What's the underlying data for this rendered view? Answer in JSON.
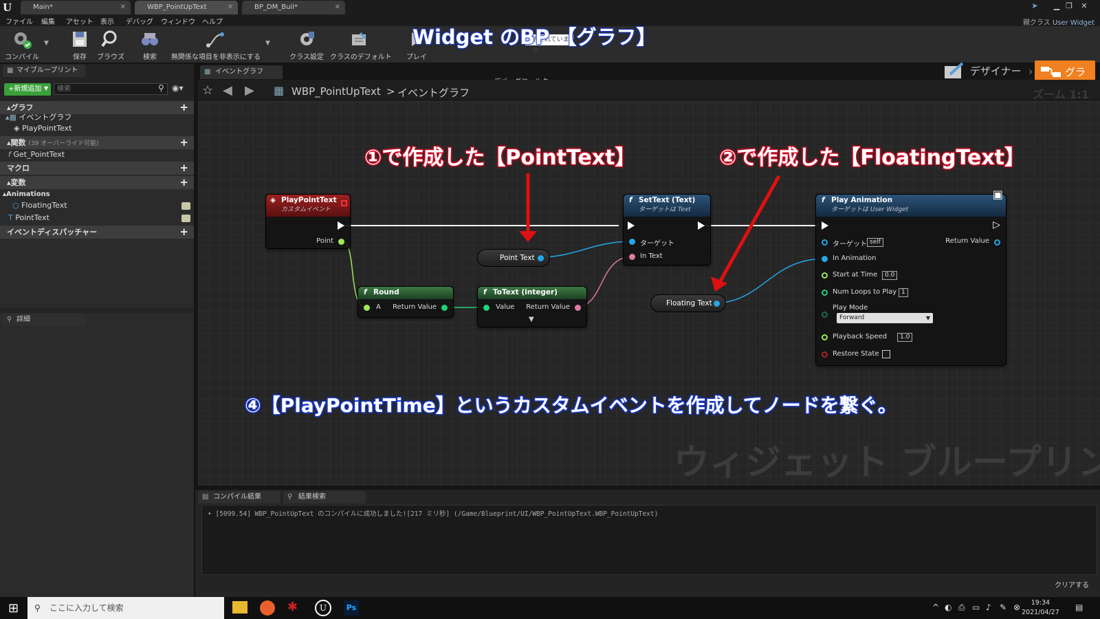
{
  "app": {
    "tabs": [
      {
        "label": "Main*",
        "active": false
      },
      {
        "label": "WBP_PointUpText",
        "active": true
      },
      {
        "label": "BP_DM_Buil*",
        "active": false
      }
    ],
    "parent_class_label": "親クラス",
    "parent_class_value": "User Widget"
  },
  "menu": [
    "ファイル",
    "編集",
    "アセット",
    "表示",
    "デバッグ",
    "ウィンドウ",
    "ヘルプ"
  ],
  "toolbar": {
    "compile": "コンパイル",
    "save": "保存",
    "browse": "ブラウズ",
    "find": "検索",
    "hide_unrelated": "無関係な項目を非表示にする",
    "class_settings": "クラス設定",
    "class_defaults": "クラスのデフォルト",
    "play": "プレイ",
    "debug_filter": "デバッグフィルター",
    "debug_partial": "沢されていませ",
    "designer": "デザイナー",
    "graph": "グラフ",
    "overlay_title": "Widget のBP 【グラフ】"
  },
  "my_blueprint": {
    "tab": "マイブループリント",
    "add_new": "+新規追加",
    "search_placeholder": "検索",
    "categories": {
      "graph": "グラフ",
      "functions": "関数",
      "functions_note": "(39 オーバーライド可能)",
      "macros": "マクロ",
      "variables": "変数",
      "animations": "Animations",
      "dispatchers": "イベントディスパッチャー"
    },
    "graph_items": [
      "イベントグラフ",
      "PlayPointText"
    ],
    "function_items": [
      "Get_PointText"
    ],
    "animation_items": [
      "FloatingText",
      "PointText"
    ]
  },
  "details": {
    "tab": "詳細"
  },
  "graph": {
    "tab": "イベントグラフ",
    "breadcrumb_root": "WBP_PointUpText",
    "breadcrumb_sep": ">",
    "breadcrumb_leaf": "イベントグラフ",
    "zoom": "ズーム 1:1",
    "watermark": "ウィジェット ブループリント"
  },
  "nodes": {
    "event": {
      "title": "PlayPointText",
      "sub": "カスタムイベント",
      "pin_point": "Point"
    },
    "round": {
      "title": "Round",
      "pin_a": "A",
      "pin_ret": "Return Value"
    },
    "totext": {
      "title": "ToText (integer)",
      "pin_value": "Value",
      "pin_ret": "Return Value"
    },
    "point_text": {
      "label": "Point Text"
    },
    "settext": {
      "title": "SetText (Text)",
      "sub": "ターゲットは Text",
      "pin_target": "ターゲット",
      "pin_intext": "In Text"
    },
    "floating_text": {
      "label": "Floating Text"
    },
    "play_anim": {
      "title": "Play Animation",
      "sub": "ターゲットは User Widget",
      "pin_target": "ターゲット",
      "target_value": "self",
      "pin_ret": "Return Value",
      "pin_in_anim": "In Animation",
      "pin_start": "Start at Time",
      "start_value": "0.0",
      "pin_loops": "Num Loops to Play",
      "loops_value": "1",
      "pin_mode": "Play Mode",
      "mode_value": "Forward",
      "pin_speed": "Playback Speed",
      "speed_value": "1.0",
      "pin_restore": "Restore State"
    }
  },
  "annotations": {
    "a1": "①で作成した【PointText】",
    "a2": "②で作成した【FloatingText】",
    "a4": "④【PlayPointTime】というカスタムイベントを作成してノードを繋ぐ。"
  },
  "compile": {
    "tab_results": "コンパイル結果",
    "tab_find": "結果検索",
    "log": "• [5099.54] WBP_PointUpText のコンパイルに成功しました![217 ミリ秒] (/Game/Blueprint/UI/WBP_PointUpText.WBP_PointUpText)",
    "clear": "クリアする"
  },
  "taskbar": {
    "search_placeholder": "ここに入力して検索",
    "time": "19:34",
    "date": "2021/04/27"
  },
  "colors": {
    "accent_orange": "#f08020",
    "event_red": "#8a1c1c",
    "func_green": "#2f5a34",
    "settext_blue": "#1f3a56",
    "text_pin_pink": "#e07aa5",
    "object_pin_blue": "#24a7e8",
    "int_pin_green": "#1fd17a",
    "float_pin_green": "#a0e85a"
  }
}
